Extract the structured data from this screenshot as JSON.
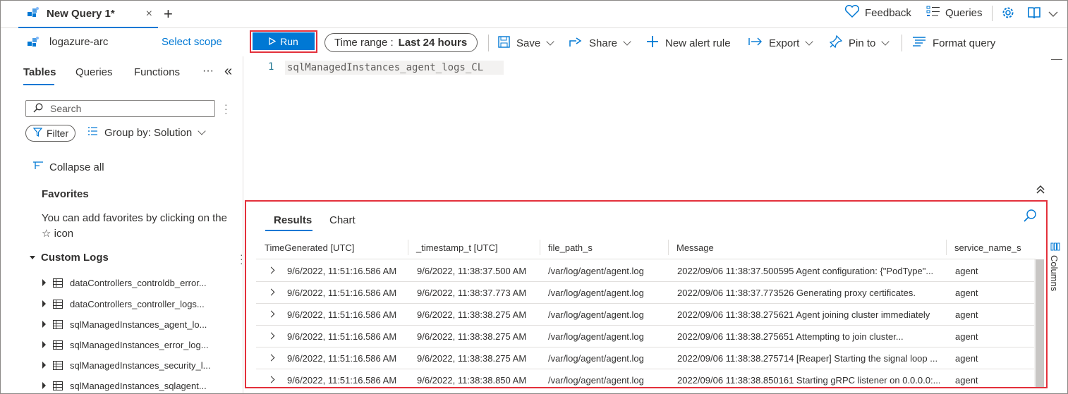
{
  "tabbar": {
    "tab_title": "New Query 1*",
    "close_glyph": "×",
    "new_tab_glyph": "+",
    "feedback_label": "Feedback",
    "queries_label": "Queries"
  },
  "toolbar": {
    "scope_name": "logazure-arc",
    "select_scope_label": "Select scope",
    "run_label": "Run",
    "time_range_prefix": "Time range :",
    "time_range_value": "Last 24 hours",
    "save_label": "Save",
    "share_label": "Share",
    "new_alert_label": "New alert rule",
    "export_label": "Export",
    "pin_label": "Pin to",
    "format_label": "Format query"
  },
  "left_panel": {
    "tabs": [
      "Tables",
      "Queries",
      "Functions"
    ],
    "more_glyph": "···",
    "collapse_glyph": "«",
    "search_placeholder": "Search",
    "filter_label": "Filter",
    "group_by_label": "Group by: Solution",
    "collapse_all_label": "Collapse all",
    "favorites_heading": "Favorites",
    "favorites_text": "You can add favorites by clicking on the ☆ icon",
    "custom_logs_heading": "Custom Logs",
    "tables": [
      "dataControllers_controldb_error...",
      "dataControllers_controller_logs...",
      "sqlManagedInstances_agent_lo...",
      "sqlManagedInstances_error_log...",
      "sqlManagedInstances_security_l...",
      "sqlManagedInstances_sqlagent..."
    ]
  },
  "editor": {
    "line_number": "1",
    "query": "sqlManagedInstances_agent_logs_CL"
  },
  "results": {
    "tabs": [
      "Results",
      "Chart"
    ],
    "columns_label": "Columns",
    "headers": [
      "TimeGenerated [UTC]",
      "_timestamp_t [UTC]",
      "file_path_s",
      "Message",
      "service_name_s"
    ],
    "rows": [
      [
        "9/6/2022, 11:51:16.586 AM",
        "9/6/2022, 11:38:37.500 AM",
        "/var/log/agent/agent.log",
        "2022/09/06 11:38:37.500595 Agent configuration: {\"PodType\"...",
        "agent"
      ],
      [
        "9/6/2022, 11:51:16.586 AM",
        "9/6/2022, 11:38:37.773 AM",
        "/var/log/agent/agent.log",
        "2022/09/06 11:38:37.773526 Generating proxy certificates.",
        "agent"
      ],
      [
        "9/6/2022, 11:51:16.586 AM",
        "9/6/2022, 11:38:38.275 AM",
        "/var/log/agent/agent.log",
        "2022/09/06 11:38:38.275621 Agent joining cluster immediately",
        "agent"
      ],
      [
        "9/6/2022, 11:51:16.586 AM",
        "9/6/2022, 11:38:38.275 AM",
        "/var/log/agent/agent.log",
        "2022/09/06 11:38:38.275651 Attempting to join cluster...",
        "agent"
      ],
      [
        "9/6/2022, 11:51:16.586 AM",
        "9/6/2022, 11:38:38.275 AM",
        "/var/log/agent/agent.log",
        "2022/09/06 11:38:38.275714 [Reaper] Starting the signal loop ...",
        "agent"
      ],
      [
        "9/6/2022, 11:51:16.586 AM",
        "9/6/2022, 11:38:38.850 AM",
        "/var/log/agent/agent.log",
        "2022/09/06 11:38:38.850161 Starting gRPC listener on 0.0.0.0:...",
        "agent"
      ]
    ]
  },
  "colors": {
    "accent": "#0078d4",
    "highlight_red": "#e3303b",
    "text": "#323130"
  }
}
